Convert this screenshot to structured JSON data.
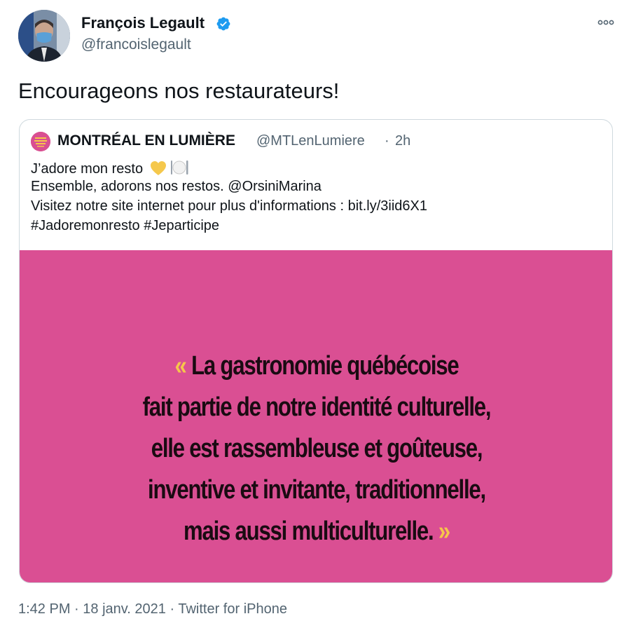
{
  "author": {
    "name": "François Legault",
    "handle": "@francoislegault"
  },
  "tweet": {
    "text": "Encourageons nos restaurateurs!"
  },
  "quoted": {
    "name": "MONTRÉAL EN LUMIÈRE",
    "handle": "@MTLenLumiere",
    "separator": "·",
    "time": "2h",
    "lines": [
      "J’adore mon resto",
      "Ensemble, adorons nos restos. @OrsiniMarina",
      "Visitez notre site internet pour plus d'informations :  bit.ly/3iid6X1",
      "#Jadoremonresto #Jeparticipe"
    ],
    "image": {
      "open_quote": "«",
      "close_quote": "»",
      "quote_lines": [
        "La gastronomie québécoise",
        "fait partie de notre identité culturelle,",
        "elle est rassembleuse et goûteuse,",
        "inventive et invitante, traditionnelle,",
        "mais aussi multiculturelle."
      ],
      "background_color": "#da4f93",
      "quote_mark_color": "#f6c64b"
    }
  },
  "meta": {
    "time": "1:42 PM",
    "date": "18 janv. 2021",
    "source": "Twitter for iPhone",
    "separator": "·"
  },
  "icons": {
    "verified": "verified-badge-icon",
    "more": "more-options-icon",
    "heart": "yellow-heart-emoji",
    "cutlery": "fork-knife-plate-emoji"
  },
  "colors": {
    "verified": "#1d9bf0",
    "secondary_text": "#536471",
    "border": "#cfd9de"
  }
}
